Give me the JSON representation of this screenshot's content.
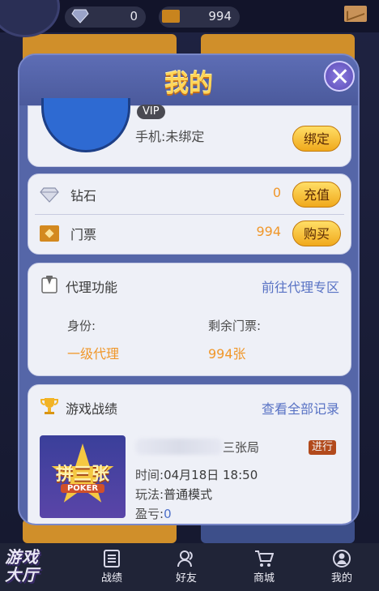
{
  "top": {
    "diamonds": "0",
    "tickets": "994"
  },
  "modal": {
    "title": "我的",
    "profile": {
      "vip": "VIP",
      "phone": "手机:未绑定",
      "bind_label": "绑定"
    },
    "currency": [
      {
        "label": "钻石",
        "amount": "0",
        "button": "充值"
      },
      {
        "label": "门票",
        "amount": "994",
        "button": "购买"
      }
    ],
    "agent": {
      "title": "代理功能",
      "link": "前往代理专区",
      "identity_label": "身份:",
      "identity_value": "一级代理",
      "tickets_label": "剩余门票:",
      "tickets_value": "994张"
    },
    "records": {
      "title": "游戏战绩",
      "link": "查看全部记录",
      "item": {
        "game_name_suffix": "三张局",
        "status": "进行",
        "time_label": "时间:",
        "time_value": "04月18日 18:50",
        "mode_label": "玩法:",
        "mode_value": "普通模式",
        "profit_label": "盈亏:",
        "profit_value": "0",
        "thumb_title": "拼三张",
        "thumb_sub": "POKER"
      }
    }
  },
  "bottom_nav": {
    "logo": "游戏大厅",
    "items": [
      {
        "label": "战绩",
        "icon": "records-icon"
      },
      {
        "label": "好友",
        "icon": "friends-icon"
      },
      {
        "label": "商城",
        "icon": "shop-cart-icon"
      },
      {
        "label": "我的",
        "icon": "profile-icon"
      }
    ]
  }
}
